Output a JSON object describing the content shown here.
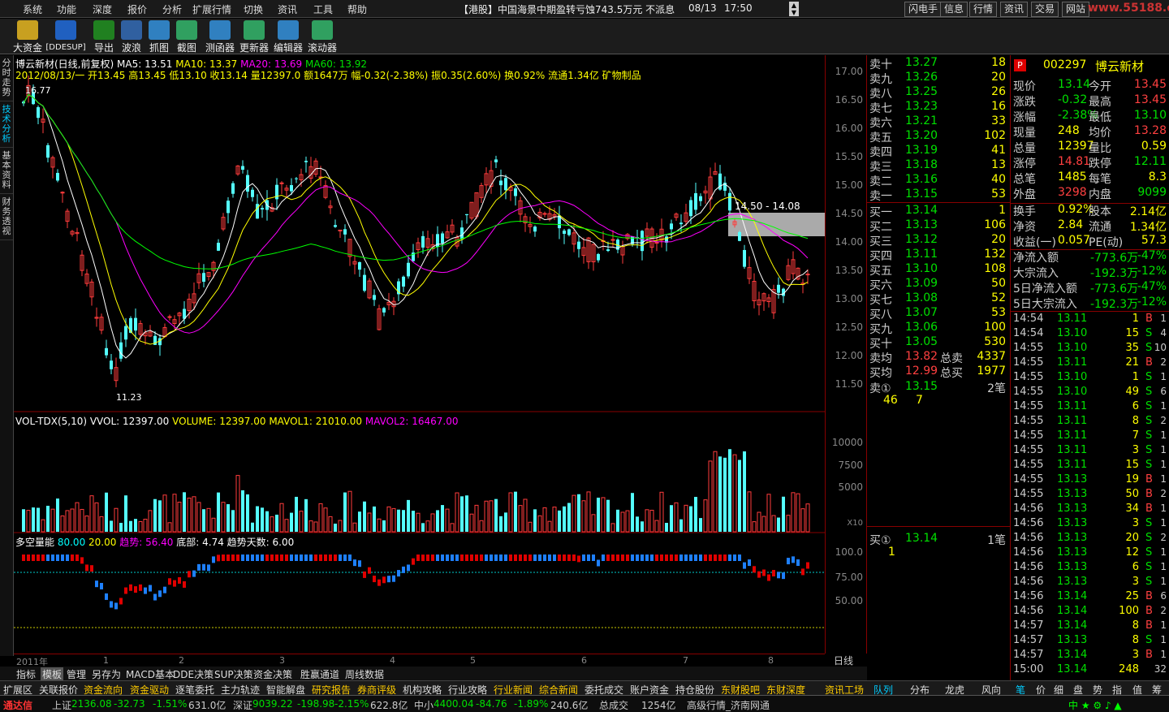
{
  "menu": [
    "系统",
    "功能",
    "深度",
    "报价",
    "分析",
    "扩展行情",
    "切换",
    "资讯",
    "工具",
    "帮助"
  ],
  "ticker": "【港股】中国海景中期盈转亏蚀743.5万元 不派息",
  "ticker_date": "08/13",
  "ticker_time": "17:50",
  "right_buttons": [
    "闪电手",
    "信息",
    "行情",
    "资讯",
    "交易",
    "网站"
  ],
  "logo": "www.55188.com",
  "toolbar": [
    "大资金",
    "[DDESUP]",
    "导出",
    "波浪",
    "抓图",
    "截图",
    "测函器",
    "更新器",
    "编辑器",
    "滚动器"
  ],
  "left_tabs": [
    "分时走势",
    "技术分析",
    "基本资料",
    "财务透视"
  ],
  "chart_title": {
    "name": "博云新材(日线,前复权)",
    "ma5": "MA5: 13.51",
    "ma10": "MA10: 13.37",
    "ma20": "MA20: 13.69",
    "ma60": "MA60: 13.92"
  },
  "ohlc_line": "2012/08/13/一 开13.45 高13.45 低13.10 收13.14 量12397.0 额1647万 幅-0.32(-2.38%) 振0.35(2.60%) 换0.92% 流通1.34亿 矿物制品",
  "annotations": {
    "high": "16.77",
    "low": "11.23",
    "box": "14.50 - 14.08"
  },
  "price_axis": [
    "17.00",
    "16.50",
    "16.00",
    "15.50",
    "15.00",
    "14.50",
    "14.00",
    "13.50",
    "13.00",
    "12.50",
    "12.00",
    "11.50"
  ],
  "vol_title": {
    "a": "VOL-TDX(5,10) VVOL: 12397.00",
    "b": "VOLUME: 12397.00",
    "c": "MAVOL1: 21010.00",
    "d": "MAVOL2: 16467.00"
  },
  "vol_axis": [
    "10000",
    "7500",
    "5000"
  ],
  "vol_unit": "X10",
  "ind_title": {
    "a": "多空量能",
    "b": "80.00",
    "c": "20.00",
    "d": "趋势: 56.40",
    "e": "底部: 4.74",
    "f": "趋势天数: 6.00"
  },
  "ind_axis": [
    "100.0",
    "75.00",
    "50.00"
  ],
  "time_axis": [
    "2011年",
    "1",
    "2",
    "3",
    "4",
    "5",
    "6",
    "7",
    "8"
  ],
  "period": "日线",
  "bottom_tabs": [
    "指标",
    "模板",
    "管理",
    "另存为",
    "MACD基本",
    "DDE决策",
    "SUP决策",
    "资金决策",
    "胜赢通道",
    "周线数据"
  ],
  "cat_bar": [
    "扩展区",
    "关联报价",
    "资金流向",
    "资金驱动",
    "逐笔委托",
    "主力轨迹",
    "智能解盘",
    "研究报告",
    "券商评级",
    "机构攻略",
    "行业攻略",
    "行业新闻",
    "综合新闻",
    "委托成交",
    "账户资金",
    "持仓股份",
    "东财股吧",
    "东财深度",
    "资讯工场"
  ],
  "right_cat": [
    "队列",
    "分布",
    "龙虎",
    "风向",
    "笔",
    "价",
    "细",
    "盘",
    "势",
    "指",
    "值",
    "筹"
  ],
  "status": {
    "brand": "通达信",
    "sh": "上证",
    "sh_v": "2136.08",
    "sh_c": "-32.73",
    "sh_p": "-1.51%",
    "sh_a": "631.0亿",
    "sz": "深证",
    "sz_v": "9039.22",
    "sz_c": "-198.98",
    "sz_p": "-2.15%",
    "sz_a": "622.8亿",
    "zx": "中小",
    "zx_v": "4400.04",
    "zx_c": "-84.76",
    "zx_p": "-1.89%",
    "zx_a": "240.6亿",
    "tr": "总成交",
    "tr_v": "1254亿",
    "src": "高级行情_济南网通"
  },
  "asks": [
    [
      "卖十",
      "13.27",
      "18"
    ],
    [
      "卖九",
      "13.26",
      "20"
    ],
    [
      "卖八",
      "13.25",
      "26"
    ],
    [
      "卖七",
      "13.23",
      "16"
    ],
    [
      "卖六",
      "13.21",
      "33"
    ],
    [
      "卖五",
      "13.20",
      "102"
    ],
    [
      "卖四",
      "13.19",
      "41"
    ],
    [
      "卖三",
      "13.18",
      "13"
    ],
    [
      "卖二",
      "13.16",
      "40"
    ],
    [
      "卖一",
      "13.15",
      "53"
    ]
  ],
  "bids": [
    [
      "买一",
      "13.14",
      "1"
    ],
    [
      "买二",
      "13.13",
      "106"
    ],
    [
      "买三",
      "13.12",
      "20"
    ],
    [
      "买四",
      "13.11",
      "132"
    ],
    [
      "买五",
      "13.10",
      "108"
    ],
    [
      "买六",
      "13.09",
      "50"
    ],
    [
      "买七",
      "13.08",
      "52"
    ],
    [
      "买八",
      "13.07",
      "53"
    ],
    [
      "买九",
      "13.06",
      "100"
    ],
    [
      "买十",
      "13.05",
      "530"
    ]
  ],
  "avg": {
    "sell_l": "卖均",
    "sell_p": "13.82",
    "sell_t": "总卖",
    "sell_v": "4337",
    "buy_l": "买均",
    "buy_p": "12.99",
    "buy_t": "总买",
    "buy_v": "1977"
  },
  "sell1_queue": {
    "l": "卖①",
    "p": "13.15",
    "n": "2笔",
    "q1": "46",
    "q2": "7"
  },
  "buy1_queue": {
    "l": "买①",
    "p": "13.14",
    "n": "1笔",
    "q1": "1"
  },
  "stock_code": "002297",
  "stock_name": "博云新材",
  "stats": [
    [
      "现价",
      "13.14",
      "今开",
      "13.45"
    ],
    [
      "涨跌",
      "-0.32",
      "最高",
      "13.45"
    ],
    [
      "涨幅",
      "-2.38%",
      "最低",
      "13.10"
    ],
    [
      "现量",
      "248",
      "均价",
      "13.28"
    ],
    [
      "总量",
      "12397",
      "量比",
      "0.59"
    ],
    [
      "涨停",
      "14.81",
      "跌停",
      "12.11"
    ],
    [
      "总笔",
      "1485",
      "每笔",
      "8.3"
    ],
    [
      "外盘",
      "3298",
      "内盘",
      "9099"
    ]
  ],
  "stats2": [
    [
      "换手",
      "0.92%",
      "股本",
      "2.14亿"
    ],
    [
      "净资",
      "2.84",
      "流通",
      "1.34亿"
    ],
    [
      "收益(一)",
      "0.057",
      "PE(动)",
      "57.3"
    ]
  ],
  "flows": [
    [
      "净流入额",
      "-773.6万",
      "-47%"
    ],
    [
      "大宗流入",
      "-192.3万",
      "-12%"
    ],
    [
      "5日净流入额",
      "-773.6万",
      "-47%"
    ],
    [
      "5日大宗流入",
      "-192.3万",
      "-12%"
    ]
  ],
  "ticks": [
    [
      "14:54",
      "13.11",
      "1",
      "B",
      "1"
    ],
    [
      "14:54",
      "13.10",
      "15",
      "S",
      "4"
    ],
    [
      "14:55",
      "13.10",
      "35",
      "S",
      "10"
    ],
    [
      "14:55",
      "13.11",
      "21",
      "B",
      "2"
    ],
    [
      "14:55",
      "13.10",
      "1",
      "S",
      "1"
    ],
    [
      "14:55",
      "13.10",
      "49",
      "S",
      "6"
    ],
    [
      "14:55",
      "13.11",
      "6",
      "S",
      "1"
    ],
    [
      "14:55",
      "13.11",
      "8",
      "S",
      "2"
    ],
    [
      "14:55",
      "13.11",
      "7",
      "S",
      "1"
    ],
    [
      "14:55",
      "13.11",
      "3",
      "S",
      "1"
    ],
    [
      "14:55",
      "13.11",
      "15",
      "S",
      "1"
    ],
    [
      "14:55",
      "13.13",
      "19",
      "B",
      "1"
    ],
    [
      "14:55",
      "13.13",
      "50",
      "B",
      "2"
    ],
    [
      "14:56",
      "13.13",
      "34",
      "B",
      "1"
    ],
    [
      "14:56",
      "13.13",
      "3",
      "S",
      "1"
    ],
    [
      "14:56",
      "13.13",
      "20",
      "S",
      "2"
    ],
    [
      "14:56",
      "13.13",
      "12",
      "S",
      "1"
    ],
    [
      "14:56",
      "13.13",
      "6",
      "S",
      "1"
    ],
    [
      "14:56",
      "13.13",
      "3",
      "S",
      "1"
    ],
    [
      "14:56",
      "13.14",
      "25",
      "B",
      "6"
    ],
    [
      "14:56",
      "13.14",
      "100",
      "B",
      "2"
    ],
    [
      "14:57",
      "13.14",
      "8",
      "B",
      "1"
    ],
    [
      "14:57",
      "13.13",
      "8",
      "S",
      "1"
    ],
    [
      "14:57",
      "13.14",
      "3",
      "B",
      "1"
    ],
    [
      "15:00",
      "13.14",
      "248",
      "",
      "32"
    ]
  ]
}
